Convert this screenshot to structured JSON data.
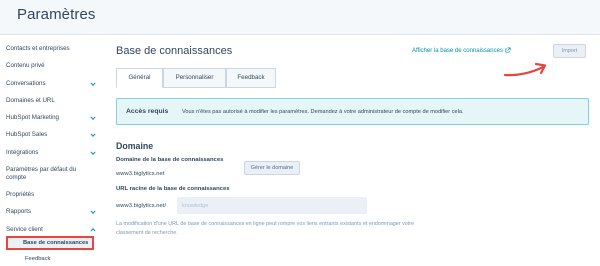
{
  "header": {
    "title": "Paramètres"
  },
  "sidebar": {
    "items": [
      {
        "label": "Contacts et entreprises"
      },
      {
        "label": "Contenu privé"
      },
      {
        "label": "Conversations"
      },
      {
        "label": "Domaines et URL"
      },
      {
        "label": "HubSpot Marketing"
      },
      {
        "label": "HubSpot Sales"
      },
      {
        "label": "Intégrations"
      },
      {
        "label": "Paramètres par défaut du compte"
      },
      {
        "label": "Propriétés"
      },
      {
        "label": "Rapports"
      },
      {
        "label": "Service client"
      }
    ],
    "sub_items": [
      {
        "label": "Base de connaissances",
        "active": true
      },
      {
        "label": "Feedback"
      }
    ],
    "highlight_color": "#e8463d"
  },
  "main": {
    "title": "Base de connaissances",
    "kb_link": "Afficher la base de connaissances",
    "import_label": "Import",
    "tabs": [
      {
        "label": "Général"
      },
      {
        "label": "Personnaliser"
      },
      {
        "label": "Feedback"
      }
    ],
    "alert": {
      "title": "Accès requis",
      "text": "Vous n'êtes pas autorisé à modifier les paramètres. Demandez à votre administrateur de compte de modifier cela."
    },
    "domain": {
      "section_title": "Domaine",
      "domain_label": "Domaine de la base de connaissances",
      "domain_value": "www3.biglytics.net",
      "manage_button": "Gérer le domaine",
      "root_url_label": "URL racine de la base de connaissances",
      "url_prefix": "www3.biglytics.net/",
      "slug_placeholder": "knowledge",
      "help_text": "La modification d'une URL de base de connaissances en ligne peut rompre vos liens entrants existants et endommager votre classement de recherche."
    }
  },
  "colors": {
    "accent": "#0091ae",
    "annotation_arrow": "#e8463d"
  }
}
